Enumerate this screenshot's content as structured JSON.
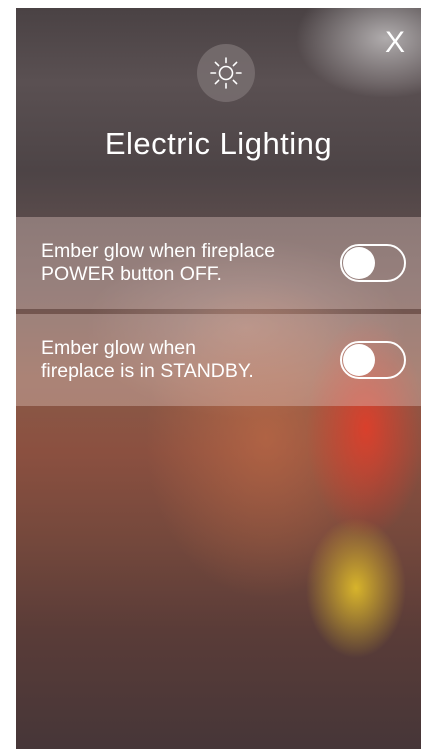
{
  "header": {
    "close_label": "X",
    "icon": "sun-icon",
    "title": "Electric Lighting"
  },
  "settings": {
    "items": [
      {
        "label": "Ember glow when fireplace\nPOWER button OFF.",
        "state": "off"
      },
      {
        "label": "Ember glow when\nfireplace is in STANDBY.",
        "state": "off"
      }
    ]
  },
  "colors": {
    "text": "#ffffff",
    "row_overlay": "#e1c8c3",
    "icon_badge": "#786e70"
  }
}
